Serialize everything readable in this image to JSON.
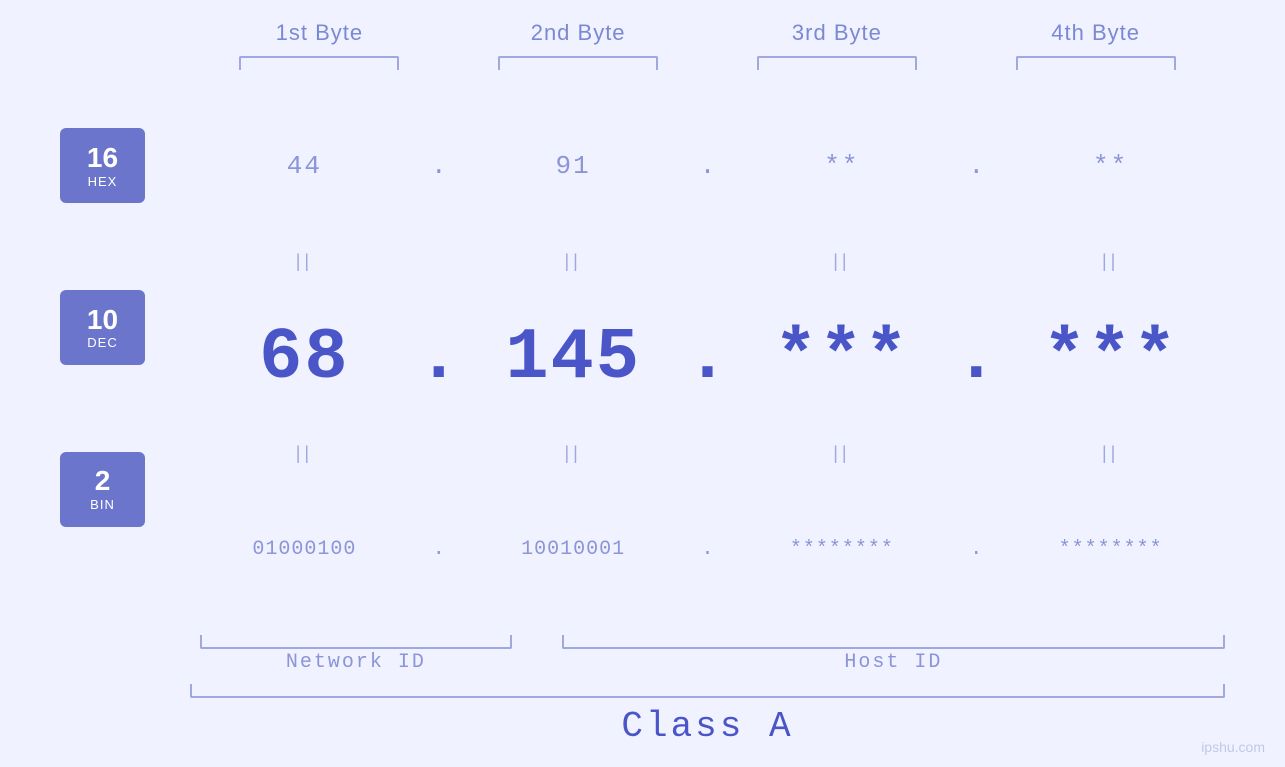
{
  "byteLabels": [
    "1st Byte",
    "2nd Byte",
    "3rd Byte",
    "4th Byte"
  ],
  "bases": [
    {
      "number": "16",
      "name": "HEX"
    },
    {
      "number": "10",
      "name": "DEC"
    },
    {
      "number": "2",
      "name": "BIN"
    }
  ],
  "hex": {
    "b1": "44",
    "b2": "91",
    "b3": "**",
    "b4": "**",
    "sep": "."
  },
  "dec": {
    "b1": "68",
    "b2": "145",
    "b3": "***",
    "b4": "***",
    "sep": "."
  },
  "bin": {
    "b1": "01000100",
    "b2": "10010001",
    "b3": "********",
    "b4": "********",
    "sep": "."
  },
  "labels": {
    "networkId": "Network ID",
    "hostId": "Host ID",
    "class": "Class A"
  },
  "watermark": "ipshu.com",
  "equals": "||"
}
